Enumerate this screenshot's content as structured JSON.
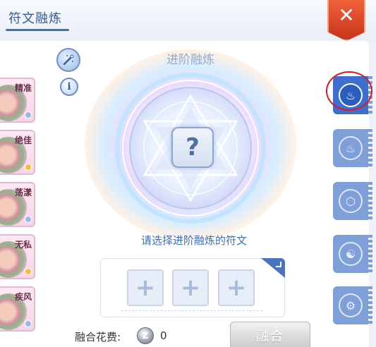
{
  "header": {
    "tab_title": "符文融炼",
    "close_icon_glyph": "✕"
  },
  "main": {
    "title": "进阶融炼",
    "question_glyph": "?",
    "select_hint": "请选择进阶融炼的符文",
    "slot_glyph": "+",
    "cost_label": "融合花费:",
    "cost_coin_glyph": "Z",
    "cost_value": "0",
    "fuse_button": "融合",
    "info_glyph": "i"
  },
  "left_list": {
    "items": [
      {
        "name": "精准",
        "badge": "blue"
      },
      {
        "name": "绝佳",
        "badge": "gold"
      },
      {
        "name": "荡漾",
        "badge": "blue"
      },
      {
        "name": "无私",
        "badge": "gold"
      },
      {
        "name": "疾风",
        "badge": "blue"
      }
    ]
  },
  "right_tabs": [
    {
      "icon": "fire-emblem-icon",
      "glyph": "♨",
      "active": true
    },
    {
      "icon": "flame-emblem-icon",
      "glyph": "♨",
      "active": false
    },
    {
      "icon": "shield-emblem-icon",
      "glyph": "⬡",
      "active": false
    },
    {
      "icon": "swirl-emblem-icon",
      "glyph": "☯",
      "active": false
    },
    {
      "icon": "gears-emblem-icon",
      "glyph": "⚙",
      "active": false
    }
  ],
  "colors": {
    "accent": "#3e6fd0",
    "close": "#d8432a",
    "hint_text": "#3f6db3"
  }
}
